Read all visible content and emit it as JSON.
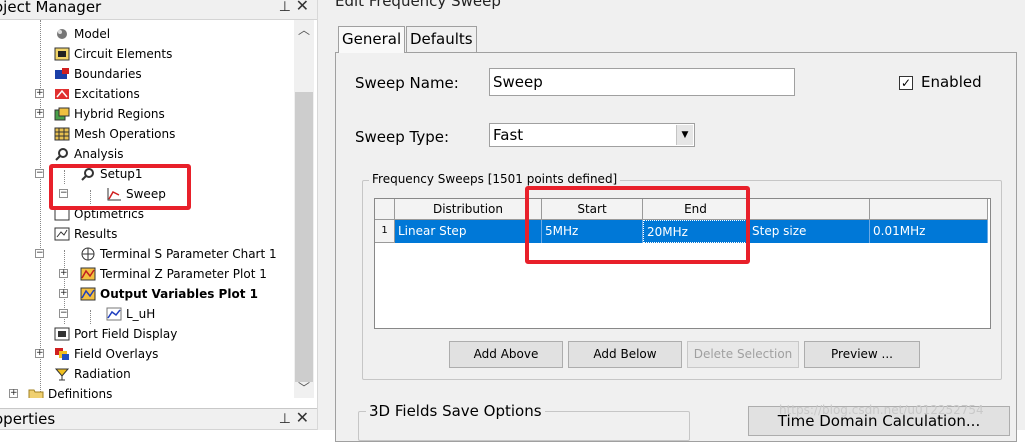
{
  "project_manager": {
    "title": "oject Manager",
    "tree": [
      {
        "label": "Model"
      },
      {
        "label": "Circuit Elements"
      },
      {
        "label": "Boundaries"
      },
      {
        "label": "Excitations"
      },
      {
        "label": "Hybrid Regions"
      },
      {
        "label": "Mesh Operations"
      },
      {
        "label": "Analysis"
      },
      {
        "label": "Setup1"
      },
      {
        "label": "Sweep"
      },
      {
        "label": "Optimetrics"
      },
      {
        "label": "Results"
      },
      {
        "label": "Terminal S Parameter Chart 1"
      },
      {
        "label": "Terminal Z Parameter Plot 1"
      },
      {
        "label": "Output Variables Plot 1"
      },
      {
        "label": "L_uH"
      },
      {
        "label": "Port Field Display"
      },
      {
        "label": "Field Overlays"
      },
      {
        "label": "Radiation"
      },
      {
        "label": "Definitions"
      }
    ]
  },
  "properties": {
    "title": "operties"
  },
  "dialog": {
    "title": "Edit Frequency Sweep",
    "tabs": [
      {
        "label": "General"
      },
      {
        "label": "Defaults"
      }
    ],
    "sweep_name_label": "Sweep Name:",
    "sweep_name_value": "Sweep",
    "enabled_label": "Enabled",
    "enabled_checked": "✓",
    "sweep_type_label": "Sweep Type:",
    "sweep_type_value": "Fast",
    "group_label": "Frequency Sweeps [1501 points defined]",
    "grid": {
      "headers": [
        "Distribution",
        "Start",
        "End",
        "",
        ""
      ],
      "row_number": "1",
      "row": [
        "Linear Step",
        "5MHz",
        "20MHz",
        "Step size",
        "0.01MHz"
      ]
    },
    "buttons": {
      "add_above": "Add Above",
      "add_below": "Add Below",
      "delete_selection": "Delete Selection",
      "preview": "Preview ..."
    },
    "fields_group_label": "3D Fields Save Options",
    "time_domain_button": "Time Domain Calculation..."
  },
  "watermark": "https://blog.csdn.net/u012252754",
  "colors": {
    "selection": "#0078d7",
    "highlight_box": "#e8202a"
  }
}
